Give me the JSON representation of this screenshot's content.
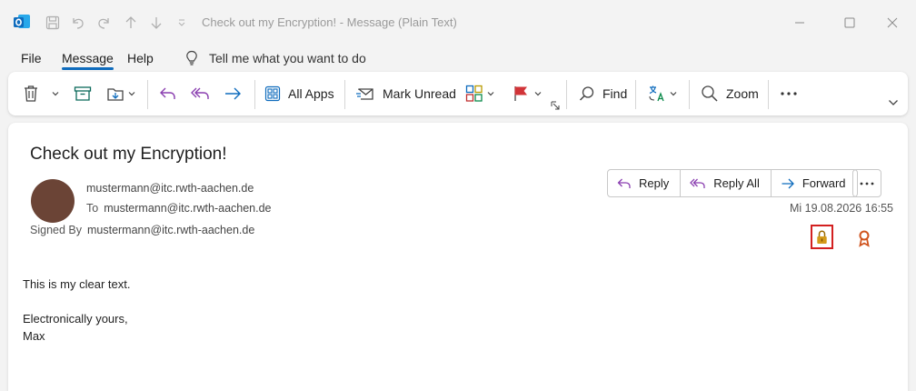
{
  "window": {
    "title": "Check out my Encryption!  -  Message (Plain Text)",
    "app_icon": "outlook-icon"
  },
  "menu": {
    "tabs": [
      {
        "label": "File"
      },
      {
        "label": "Message",
        "active": true
      },
      {
        "label": "Help"
      }
    ],
    "tell_me": "Tell me what you want to do"
  },
  "ribbon": {
    "all_apps": "All Apps",
    "mark_unread": "Mark Unread",
    "find": "Find",
    "zoom": "Zoom"
  },
  "message": {
    "subject": "Check out my Encryption!",
    "from": "mustermann@itc.rwth-aachen.de",
    "to_label": "To",
    "to": "mustermann@itc.rwth-aachen.de",
    "signed_label": "Signed By",
    "signed_by": "mustermann@itc.rwth-aachen.de",
    "date": "Mi 19.08.2026 16:55",
    "actions": {
      "reply": "Reply",
      "reply_all": "Reply All",
      "forward": "Forward"
    },
    "body": {
      "line1": "This is my clear text.",
      "line2": "Electronically yours,",
      "line3": "Max"
    }
  },
  "colors": {
    "accent": "#0f6cbd",
    "avatar": "#6b4436",
    "highlight_border": "#d32020",
    "lock": "#c8860a",
    "certificate": "#d0541e"
  }
}
